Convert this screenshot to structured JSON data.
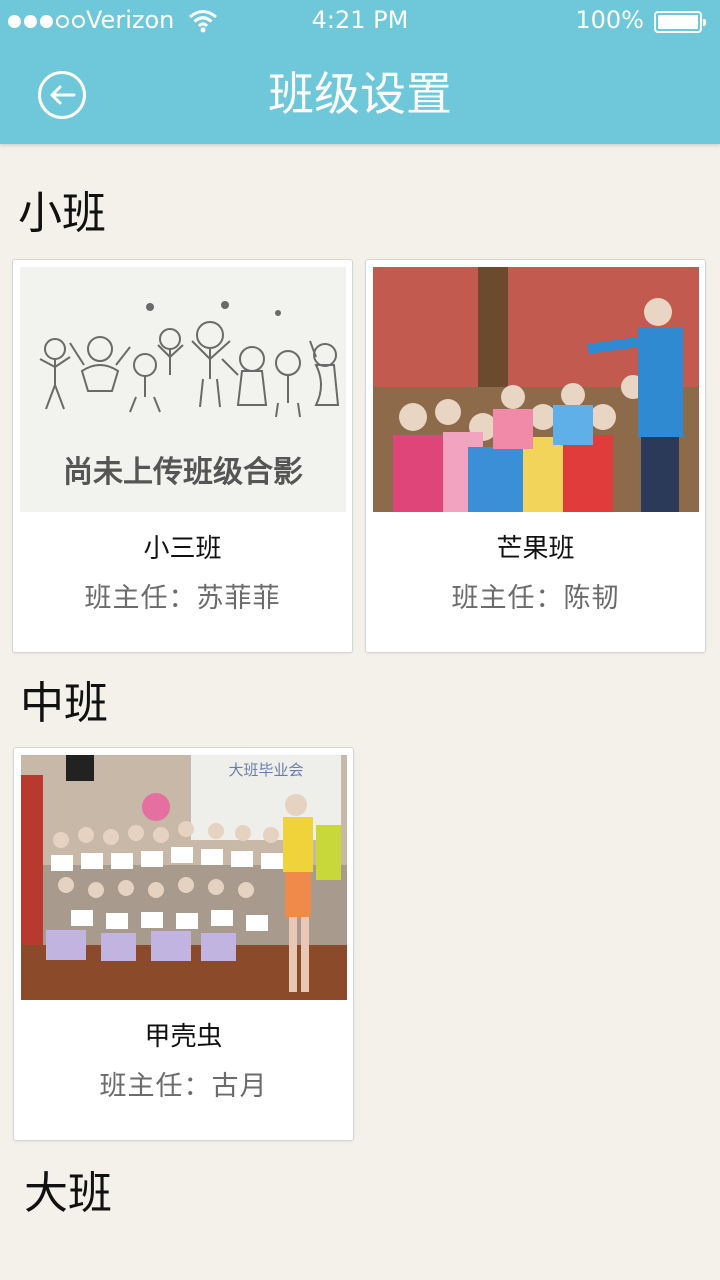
{
  "status_bar": {
    "carrier": "Verizon",
    "time": "4:21 PM",
    "battery": "100%",
    "signal_bars": 3,
    "signal_total": 5
  },
  "nav": {
    "title": "班级设置",
    "back_icon": "back-circle-arrow-icon"
  },
  "sections": [
    {
      "heading": "小班",
      "classes": [
        {
          "name": "小三班",
          "teacher": "班主任：苏菲菲",
          "photo_caption": "尚未上传班级合影"
        },
        {
          "name": "芒果班",
          "teacher": "班主任：陈韧"
        }
      ]
    },
    {
      "heading": "中班",
      "classes": [
        {
          "name": "甲壳虫",
          "teacher": "班主任：古月",
          "photo_banner": "大班毕业会"
        }
      ]
    },
    {
      "heading": "大班",
      "classes": []
    }
  ],
  "colors": {
    "header": "#6ec8d9",
    "background": "#f3f1ea",
    "card": "#ffffff",
    "teacher_text": "#6b6b6b"
  }
}
